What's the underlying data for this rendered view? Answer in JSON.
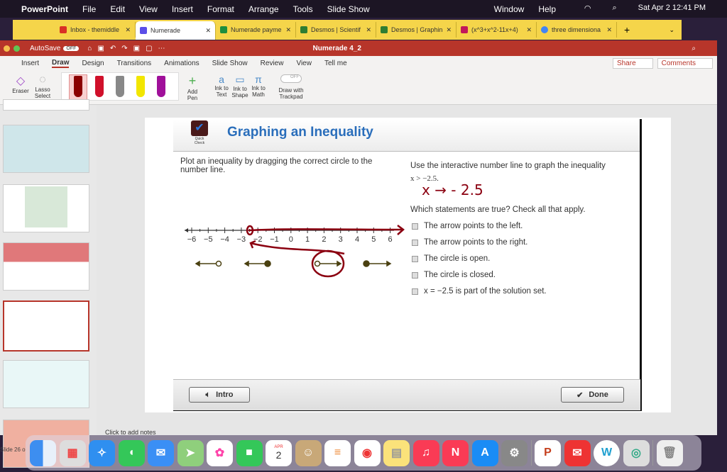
{
  "menubar": {
    "app": "PowerPoint",
    "items": [
      "File",
      "Edit",
      "View",
      "Insert",
      "Format",
      "Arrange",
      "Tools",
      "Slide Show",
      "Window",
      "Help"
    ],
    "datetime": "Sat Apr 2  12:41 PM"
  },
  "browser_tabs": [
    {
      "label": "Inbox - themiddle",
      "color": "#d93025"
    },
    {
      "label": "Numerade",
      "color": "#5b4ee8",
      "active": true
    },
    {
      "label": "Numerade payme",
      "color": "#1e8e3e"
    },
    {
      "label": "Desmos | Scientif",
      "color": "#2e7d32"
    },
    {
      "label": "Desmos | Graphin",
      "color": "#2e7d32"
    },
    {
      "label": "(x^3+x^2-11x+4)",
      "color": "#c2185b"
    },
    {
      "label": "three dimensiona",
      "color": "#4285f4"
    }
  ],
  "window": {
    "autosave": "AutoSave",
    "autosave_state": "OFF",
    "doc_title": "Numerade 4_2"
  },
  "ribbon_tabs": [
    "Insert",
    "Draw",
    "Design",
    "Transitions",
    "Animations",
    "Slide Show",
    "Review",
    "View",
    "Tell me"
  ],
  "ribbon": {
    "eraser": "Eraser",
    "lasso": "Lasso Select",
    "add_pen": "Add Pen",
    "ink_text": "Ink to Text",
    "ink_shape": "Ink to Shape",
    "ink_math": "Ink to Math",
    "trackpad_toggle": "OFF",
    "trackpad": "Draw with Trackpad",
    "share": "Share",
    "comments": "Comments",
    "pen_colors": [
      "#8b0000",
      "#d0102a",
      "#888888",
      "#f2e600",
      "#a0109a"
    ]
  },
  "slide": {
    "quick_check": "Quick Check",
    "title": "Graphing an Inequality",
    "instruction": "Plot an inequality by dragging the correct circle to the number line.",
    "prompt": "Use the interactive number line to graph the inequality",
    "inequality": "x > −2.5.",
    "handwriting": "x → - 2.5",
    "question": "Which statements are true? Check all that apply.",
    "statements": [
      "The arrow points to the left.",
      "The arrow points to the right.",
      "The circle is open.",
      "The circle is closed.",
      "x = −2.5 is part of the solution set."
    ],
    "number_line": [
      "−6",
      "−5",
      "−4",
      "−3",
      "−2",
      "−1",
      "0",
      "1",
      "2",
      "3",
      "4",
      "5",
      "6"
    ],
    "intro_button": "Intro",
    "done_button": "Done"
  },
  "notes_placeholder": "Click to add notes",
  "status": "Slide 26 o",
  "dock": {
    "calendar_month": "APR",
    "calendar_day": "2"
  }
}
